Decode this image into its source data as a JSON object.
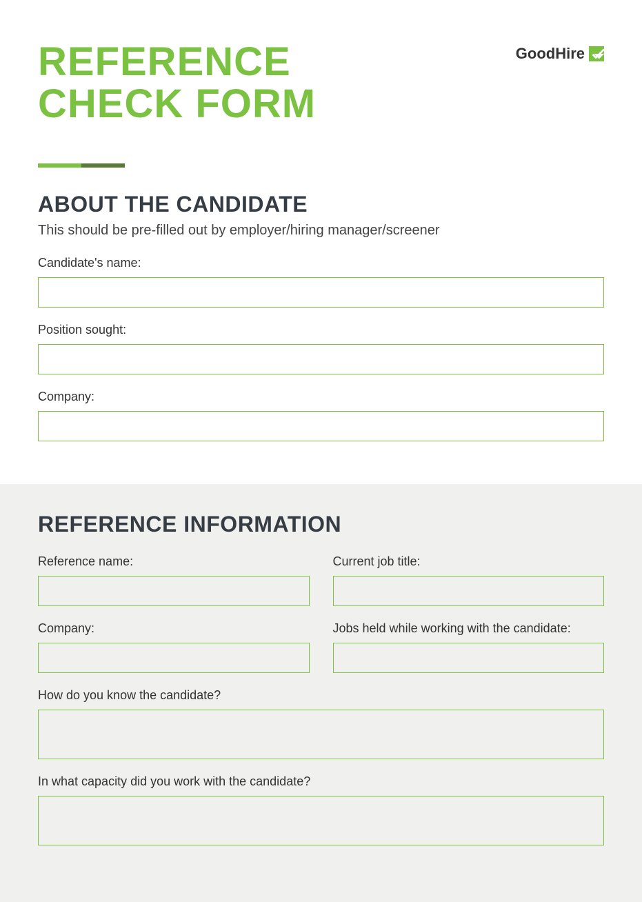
{
  "header": {
    "title_line1": "REFERENCE",
    "title_line2": "CHECK FORM",
    "brand": "GoodHire"
  },
  "section1": {
    "heading": "ABOUT THE CANDIDATE",
    "subhead": "This should be pre-filled out by employer/hiring manager/screener",
    "fields": {
      "candidate_name": {
        "label": "Candidate's name:",
        "value": ""
      },
      "position_sought": {
        "label": "Position sought:",
        "value": ""
      },
      "company": {
        "label": "Company:",
        "value": ""
      }
    }
  },
  "section2": {
    "heading": "REFERENCE INFORMATION",
    "fields": {
      "reference_name": {
        "label": "Reference name:",
        "value": ""
      },
      "current_title": {
        "label": "Current job title:",
        "value": ""
      },
      "company": {
        "label": "Company:",
        "value": ""
      },
      "jobs_held": {
        "label": "Jobs held while working with the candidate:",
        "value": ""
      },
      "how_know": {
        "label": "How do you know the candidate?",
        "value": ""
      },
      "capacity": {
        "label": "In what capacity did you work with the candidate?",
        "value": ""
      }
    }
  }
}
